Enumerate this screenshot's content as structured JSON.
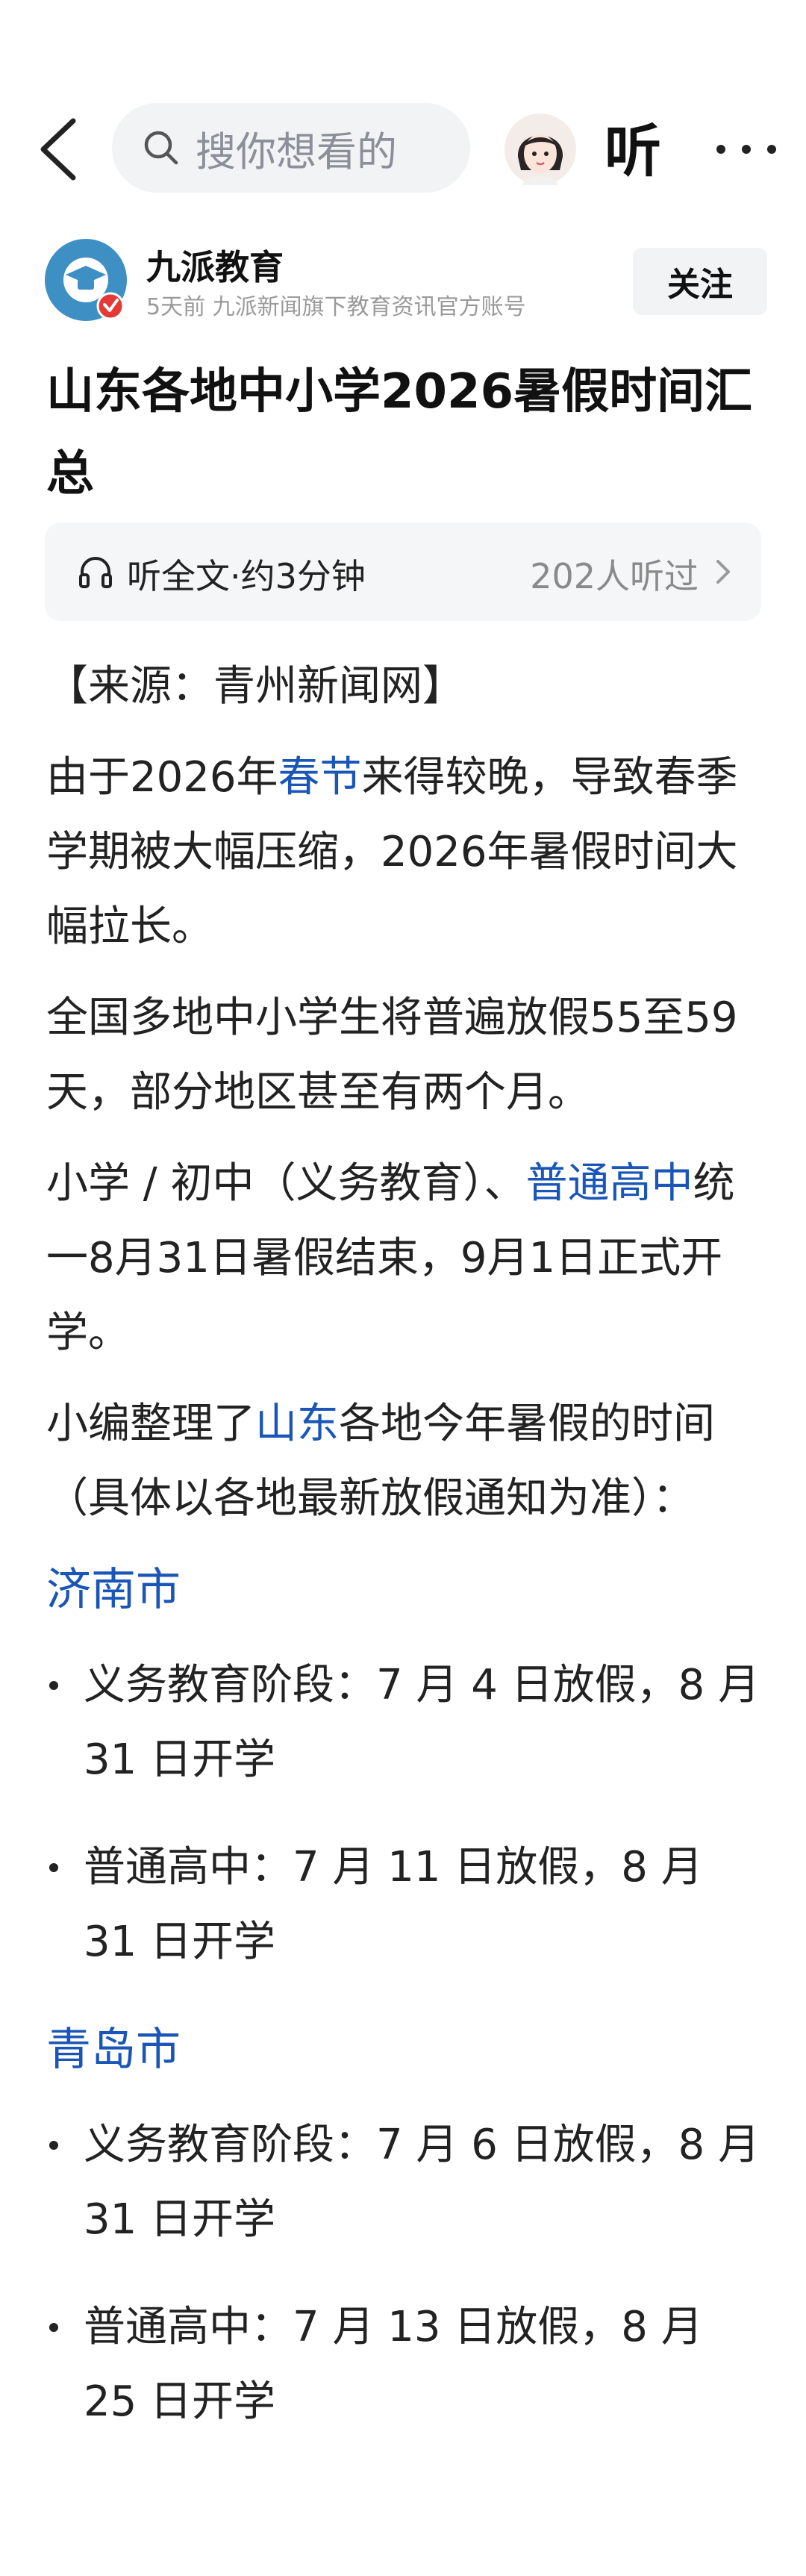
{
  "header": {
    "search_placeholder": "搜你想看的",
    "listen_label": "听",
    "icons": [
      "back-icon",
      "search-icon",
      "avatar-icon",
      "more-icon"
    ]
  },
  "author": {
    "name": "九派教育",
    "meta": "5天前  九派新闻旗下教育资讯官方账号",
    "follow_label": "关注",
    "badge_color": "#e53935"
  },
  "article": {
    "title": "山东各地中小学2026暑假时间汇总",
    "listen_bar": {
      "label": "听全文·约3分钟",
      "count": "202人听过"
    },
    "source": "【来源：青州新闻网】",
    "p1": {
      "a": "由于2026年",
      "link": "春节",
      "b": "来得较晚，导致春季学期被大幅压缩，2026年暑假时间大幅拉长。"
    },
    "p2": "全国多地中小学生将普遍放假55至59天，部分地区甚至有两个月。",
    "p3": {
      "a": "小学 / 初中（义务教育）、",
      "link": "普通高中",
      "b": "统一8月31日暑假结束，9月1日正式开学。"
    },
    "p4": {
      "a": "小编整理了",
      "link": "山东",
      "b": "各地今年暑假的时间（具体以各地最新放假通知为准）："
    },
    "cities": [
      {
        "name": "济南市",
        "items": [
          "义务教育阶段：7 月 4 日放假，8 月 31 日开学",
          "普通高中：7 月 11 日放假，8 月 31 日开学"
        ]
      },
      {
        "name": "青岛市",
        "items": [
          "义务教育阶段：7 月 6 日放假，8 月 31 日开学",
          "普通高中：7 月 13 日放假，8 月 25 日开学"
        ]
      }
    ]
  },
  "colors": {
    "link": "#1a56b8",
    "accent_blue": "#3e8fc4"
  }
}
